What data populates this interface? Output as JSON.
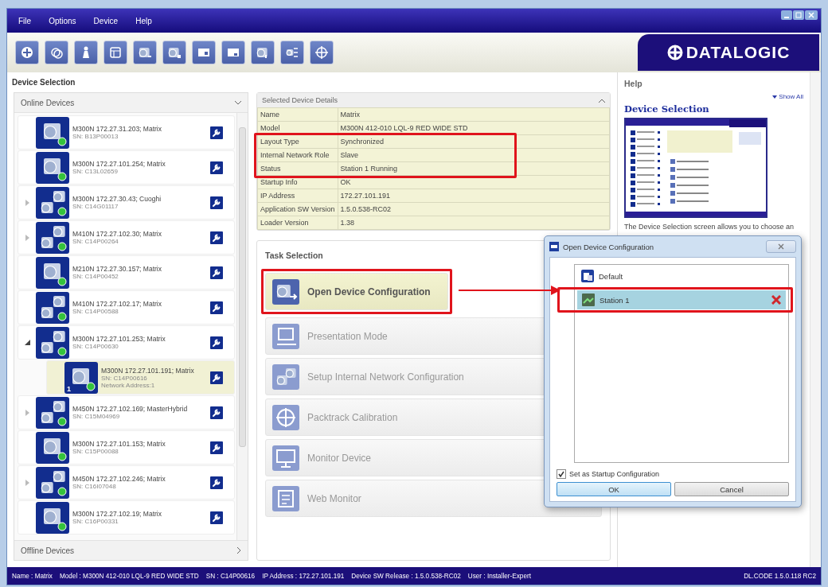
{
  "menu": [
    "File",
    "Options",
    "Device",
    "Help"
  ],
  "logo": {
    "text": "DATALOGIC"
  },
  "device_selection": {
    "title": "Device Selection",
    "online_devices": {
      "title": "Online Devices",
      "items": [
        {
          "name": "M300N 172.27.31.203; Matrix",
          "sn": "SN: B13P00013",
          "kind": "single",
          "selected": false
        },
        {
          "name": "M300N 172.27.101.254; Matrix",
          "sn": "SN: C13L02659",
          "kind": "single",
          "selected": false
        },
        {
          "name": "M300N 172.27.30.43; Cuoghi",
          "sn": "SN: C14G01117",
          "kind": "multi",
          "expanded": false,
          "selected": false
        },
        {
          "name": "M410N 172.27.102.30; Matrix",
          "sn": "SN: C14P00264",
          "kind": "multi",
          "expanded": false,
          "selected": false
        },
        {
          "name": "M210N 172.27.30.157; Matrix",
          "sn": "SN: C14P00452",
          "kind": "single",
          "selected": false
        },
        {
          "name": "M410N 172.27.102.17; Matrix",
          "sn": "SN: C14P00588",
          "kind": "multi",
          "selected": false
        },
        {
          "name": "M300N 172.27.101.253; Matrix",
          "sn": "SN: C14P00630",
          "kind": "multi",
          "expanded": true,
          "selected": false,
          "children": [
            {
              "name": "M300N 172.27.101.191; Matrix",
              "sn": "SN: C14P00616",
              "address": "Network Address:1",
              "badge": "1",
              "kind": "single",
              "selected": true
            }
          ]
        },
        {
          "name": "M450N 172.27.102.169; MasterHybrid",
          "sn": "SN: C15M04969",
          "kind": "multi",
          "expanded": false,
          "selected": false
        },
        {
          "name": "M300N 172.27.101.153; Matrix",
          "sn": "SN: C15P00088",
          "kind": "single",
          "selected": false
        },
        {
          "name": "M450N 172.27.102.246; Matrix",
          "sn": "SN: C16I07048",
          "kind": "multi",
          "expanded": false,
          "selected": false
        },
        {
          "name": "M300N 172.27.102.19; Matrix",
          "sn": "SN: C16P00331",
          "kind": "single",
          "selected": false
        }
      ]
    },
    "offline_devices": {
      "title": "Offline Devices"
    },
    "details": {
      "title": "Selected Device Details",
      "rows": [
        {
          "label": "Name",
          "value": "Matrix"
        },
        {
          "label": "Model",
          "value": "M300N 412-010 LQL-9 RED WIDE STD"
        },
        {
          "label": "Layout Type",
          "value": "Synchronized"
        },
        {
          "label": "Internal Network Role",
          "value": "Slave"
        },
        {
          "label": "Status",
          "value": "Station 1  Running"
        },
        {
          "label": "Startup Info",
          "value": "OK"
        },
        {
          "label": "IP Address",
          "value": "172.27.101.191"
        },
        {
          "label": "Application SW Version",
          "value": "1.5.0.538-RC02"
        },
        {
          "label": "Loader Version",
          "value": "1.38"
        }
      ]
    },
    "task_selection": {
      "title": "Task Selection",
      "items": [
        {
          "label": "Open Device Configuration",
          "selected": true
        },
        {
          "label": "Presentation Mode",
          "selected": false
        },
        {
          "label": "Setup Internal Network Configuration",
          "selected": false
        },
        {
          "label": "Packtrack Calibration",
          "selected": false
        },
        {
          "label": "Monitor Device",
          "selected": false
        },
        {
          "label": "Web Monitor",
          "selected": false
        }
      ]
    }
  },
  "help": {
    "title": "Help",
    "show_all": "Show All",
    "heading": "Device Selection",
    "text": "The Device Selection screen allows you to choose an"
  },
  "dialog": {
    "title": "Open Device Configuration",
    "items": [
      {
        "label": "Default",
        "selected": false
      },
      {
        "label": "Station 1",
        "selected": true
      }
    ],
    "startup": {
      "label": "Set as Startup Configuration",
      "checked": true
    },
    "buttons": [
      "OK",
      "Cancel"
    ]
  },
  "status_bar": {
    "fields": [
      "Name : Matrix",
      "Model : M300N 412-010 LQL-9 RED WIDE STD",
      "SN : C14P00616",
      "IP Address :  172.27.101.191",
      "Device SW Release : 1.5.0.538-RC02",
      "User : Installer-Expert"
    ],
    "version": "DL.CODE 1.5.0.118 RC2"
  }
}
